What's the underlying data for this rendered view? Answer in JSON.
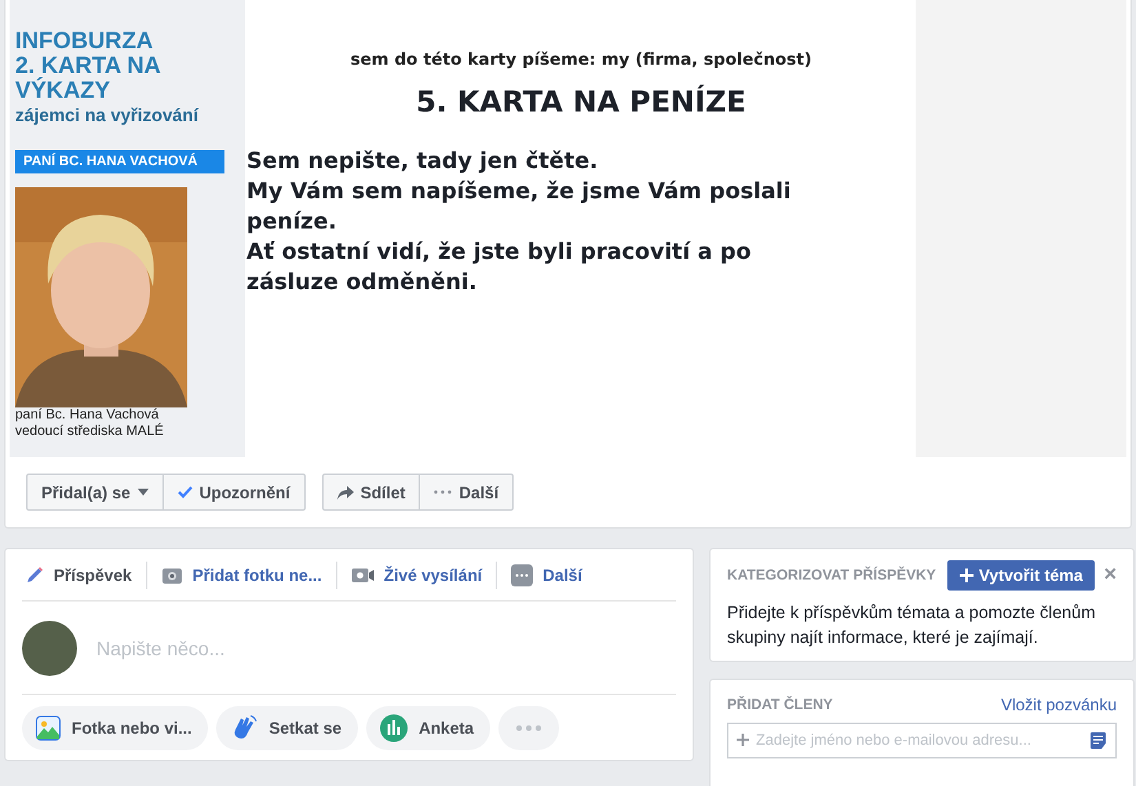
{
  "cover": {
    "sidebar": {
      "headline": [
        "INFOBURZA",
        "2. KARTA NA",
        "VÝKAZY"
      ],
      "subtitle": "zájemci na vyřizování",
      "name_badge": "PANÍ BC. HANA VACHOVÁ",
      "photo": {
        "kind": "picture"
      },
      "caption": [
        "paní Bc. Hana Vachová",
        "vedoucí střediska MALÉ"
      ]
    },
    "document": {
      "note": "sem do této karty píšeme: my (firma, společnost)",
      "title": "5. KARTA NA PENÍZE",
      "body": [
        "Sem nepište, tady jen čtěte.",
        "My Vám sem napíšeme, že jsme Vám poslali peníze.",
        "Ať ostatní vidí, že jste byli pracovití a po zásluze odměněni."
      ]
    }
  },
  "actions": [
    [
      {
        "kind": "dropdown",
        "label": "Přidal(a) se"
      },
      {
        "kind": "check",
        "label": "Upozornění"
      }
    ],
    [
      {
        "kind": "share",
        "label": "Sdílet"
      },
      {
        "kind": "more",
        "label": "Další"
      }
    ]
  ],
  "composer": {
    "tabs": [
      {
        "label": "Příspěvek",
        "selected": true
      },
      {
        "label": "Přidat fotku ne...",
        "selected": false
      },
      {
        "label": "Živé vysílání",
        "selected": false
      },
      {
        "label": "Další",
        "selected": false
      }
    ],
    "placeholder": "Napište něco...",
    "chips": [
      {
        "label": "Fotka nebo vi..."
      },
      {
        "label": "Setkat se"
      },
      {
        "label": "Anketa"
      },
      {
        "kind": "more"
      }
    ]
  },
  "topics": {
    "heading": "KATEGORIZOVAT PŘÍSPĚVKY",
    "button": "Vytvořit téma",
    "close": "×",
    "text": "Přidejte k příspěvkům témata a pomozte členům skupiny najít informace, které je zajímají."
  },
  "members": {
    "heading": "PŘIDAT ČLENY",
    "link": "Vložit pozvánku",
    "placeholder": "Zadejte jméno nebo e-mailovou adresu..."
  }
}
